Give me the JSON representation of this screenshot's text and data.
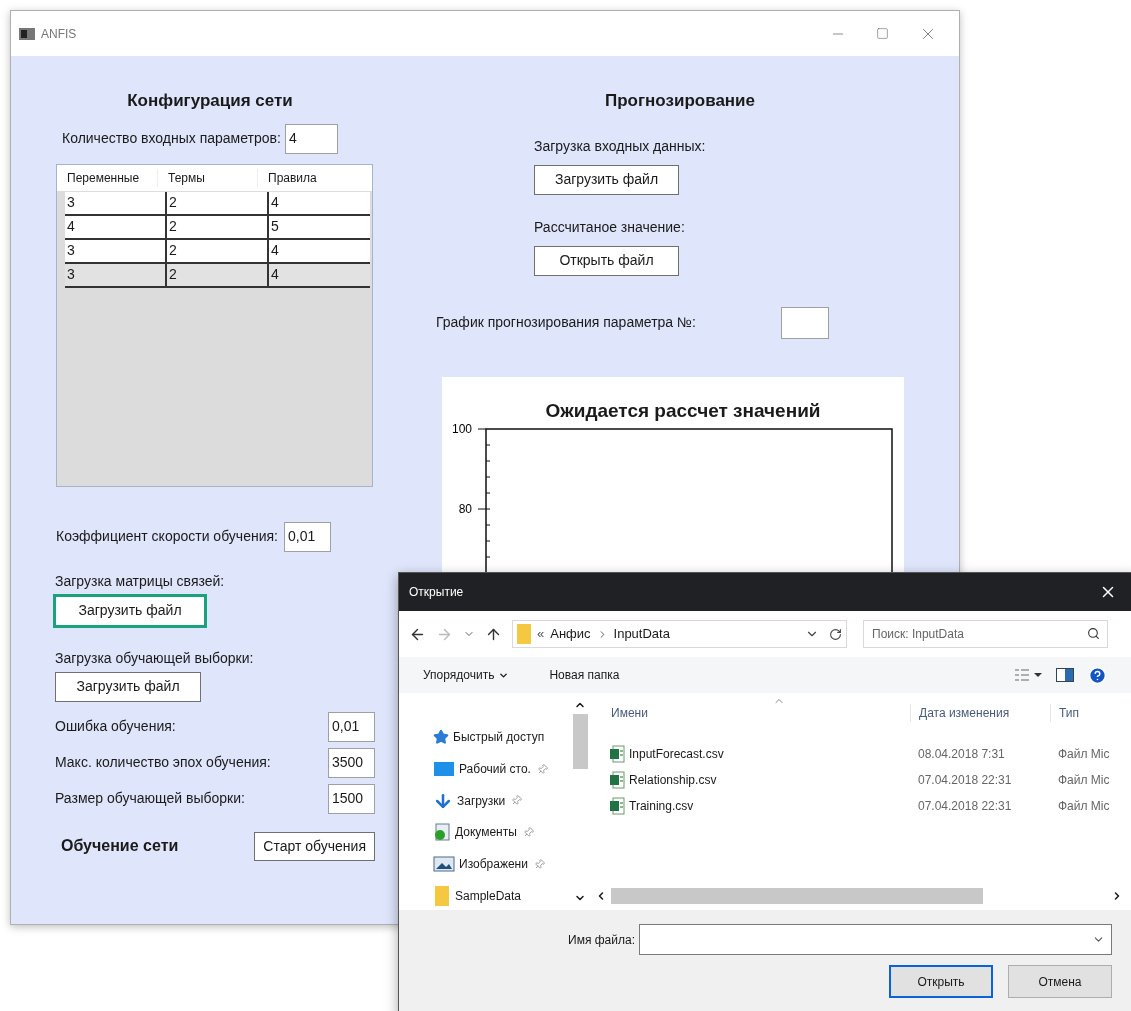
{
  "window": {
    "title": "ANFIS"
  },
  "config": {
    "heading": "Конфигурация сети",
    "inputs_label": "Количество входных параметров:",
    "inputs_value": "4",
    "table": {
      "columns": [
        "Переменные",
        "Термы",
        "Правила"
      ],
      "rows": [
        {
          "cells": [
            "3",
            "2",
            "4"
          ],
          "selected": false
        },
        {
          "cells": [
            "4",
            "2",
            "5"
          ],
          "selected": false
        },
        {
          "cells": [
            "3",
            "2",
            "4"
          ],
          "selected": false
        },
        {
          "cells": [
            "3",
            "2",
            "4"
          ],
          "selected": true
        }
      ]
    },
    "rate_label": "Коэффициент скорости обучения:",
    "rate_value": "0,01",
    "matrix_label": "Загрузка матрицы связей:",
    "matrix_button": {
      "label": "Загрузить файл",
      "focused": true
    },
    "sample_label": "Загрузка обучающей выборки:",
    "sample_button": {
      "label": "Загрузить файл",
      "focused": false
    },
    "params": [
      {
        "label": "Ошибка обучения:",
        "value": "0,01"
      },
      {
        "label": "Макс. количество эпох обучения:",
        "value": "3500"
      },
      {
        "label": "Размер обучающей выборки:",
        "value": "1500"
      }
    ],
    "train_heading": "Обучение сети",
    "train_button": "Старт обучения"
  },
  "forecast": {
    "heading": "Прогнозирование",
    "input_label": "Загрузка входных данных:",
    "input_button": "Загрузить файл",
    "result_label": "Рассчитаное значение:",
    "result_button": "Открыть файл",
    "param_label": "График прогнозирования параметра №:",
    "chart": {
      "title": "Ожидается рассчет значений",
      "y_tick_labels": [
        "100",
        "80"
      ]
    }
  },
  "dialog": {
    "title": "Открытие",
    "path_overflow": "«",
    "path": [
      "Анфис",
      "InputData"
    ],
    "search": {
      "placeholder": "Поиск: InputData"
    },
    "toolbar": {
      "organize": "Упорядочить",
      "new_folder": "Новая папка"
    },
    "nav": [
      {
        "label": "Быстрый доступ",
        "kind": "quick",
        "pinned": false
      },
      {
        "label": "Рабочий сто.",
        "kind": "desktop",
        "pinned": true
      },
      {
        "label": "Загрузки",
        "kind": "downloads",
        "pinned": true
      },
      {
        "label": "Документы",
        "kind": "documents",
        "pinned": true
      },
      {
        "label": "Изображени",
        "kind": "pictures",
        "pinned": true
      },
      {
        "label": "SampleData",
        "kind": "folder",
        "pinned": false
      }
    ],
    "columns": [
      "Имени",
      "Дата изменения",
      "Тип"
    ],
    "files": [
      {
        "name": "InputForecast.csv",
        "modified": "08.04.2018 7:31",
        "type": "Файл Mic"
      },
      {
        "name": "Relationship.csv",
        "modified": "07.04.2018 22:31",
        "type": "Файл Mic"
      },
      {
        "name": "Training.csv",
        "modified": "07.04.2018 22:31",
        "type": "Файл Mic"
      }
    ],
    "filename_label": "Имя файла:",
    "buttons": [
      {
        "label": "Открыть",
        "default": true
      },
      {
        "label": "Отмена",
        "default": false
      }
    ]
  }
}
